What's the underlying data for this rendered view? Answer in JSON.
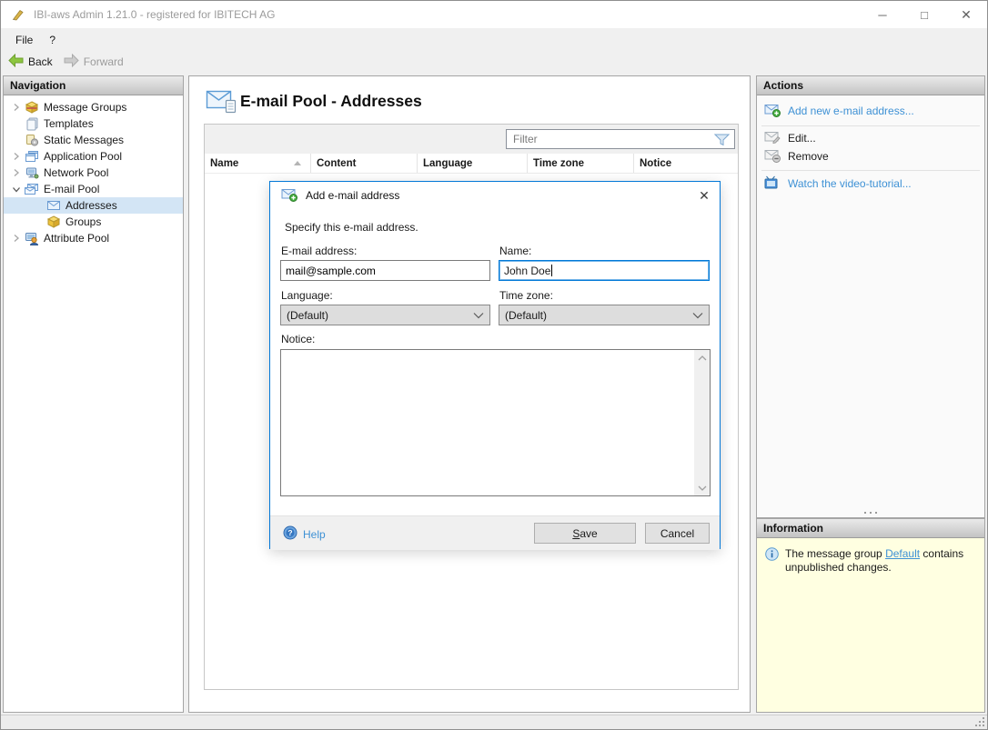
{
  "window": {
    "title": "IBI-aws Admin 1.21.0 - registered for IBITECH AG",
    "minimize": "─",
    "maximize": "□",
    "close": "✕"
  },
  "menubar": {
    "items": [
      {
        "label": "File"
      },
      {
        "label": "?"
      }
    ]
  },
  "toolbar": {
    "back": "Back",
    "forward": "Forward"
  },
  "navigation": {
    "header": "Navigation",
    "items": [
      {
        "label": "Message Groups",
        "icon": "package-icon",
        "state": "collapsed",
        "level": 0,
        "selected": false
      },
      {
        "label": "Templates",
        "icon": "templates-icon",
        "state": "leaf",
        "level": 0,
        "selected": false
      },
      {
        "label": "Static Messages",
        "icon": "static-messages-icon",
        "state": "leaf",
        "level": 0,
        "selected": false
      },
      {
        "label": "Application Pool",
        "icon": "application-pool-icon",
        "state": "collapsed",
        "level": 0,
        "selected": false
      },
      {
        "label": "Network Pool",
        "icon": "network-pool-icon",
        "state": "collapsed",
        "level": 0,
        "selected": false
      },
      {
        "label": "E-mail Pool",
        "icon": "email-pool-icon",
        "state": "expanded",
        "level": 0,
        "selected": false
      },
      {
        "label": "Addresses",
        "icon": "envelope-icon",
        "state": "leaf",
        "level": 1,
        "selected": true
      },
      {
        "label": "Groups",
        "icon": "package-icon",
        "state": "leaf",
        "level": 1,
        "selected": false
      },
      {
        "label": "Attribute Pool",
        "icon": "attribute-pool-icon",
        "state": "collapsed",
        "level": 0,
        "selected": false
      }
    ]
  },
  "main": {
    "title": "E-mail Pool - Addresses",
    "filter": {
      "placeholder": "Filter"
    },
    "table": {
      "columns": [
        "Name",
        "Content",
        "Language",
        "Time zone",
        "Notice"
      ],
      "sorted_by": "Name",
      "sort_direction": "ascending",
      "rows": []
    }
  },
  "actions": {
    "header": "Actions",
    "items": [
      {
        "label": "Add new e-mail address...",
        "enabled": true
      },
      {
        "label": "Edit...",
        "enabled": false
      },
      {
        "label": "Remove",
        "enabled": false
      },
      {
        "label": "Watch the video-tutorial...",
        "enabled": true
      }
    ]
  },
  "information": {
    "header": "Information",
    "text_before": "The message group ",
    "link_text": "Default",
    "text_after": " contains unpublished changes."
  },
  "dialog": {
    "title": "Add e-mail address",
    "close": "✕",
    "description": "Specify this e-mail address.",
    "email_label": "E-mail address:",
    "email_value": "mail@sample.com",
    "name_label": "Name:",
    "name_value": "John Doe",
    "language_label": "Language:",
    "language_value": "(Default)",
    "timezone_label": "Time zone:",
    "timezone_value": "(Default)",
    "notice_label": "Notice:",
    "notice_value": "",
    "help": "Help",
    "save_mnemonic": "S",
    "save_rest": "ave",
    "cancel": "Cancel"
  },
  "colors": {
    "accent": "#0078d7",
    "link": "#3e91d5",
    "selection": "#d3e5f5",
    "info_bg": "#ffffe1",
    "panel_header_top": "#eaeaea",
    "panel_header_bottom": "#c3c3c3"
  }
}
